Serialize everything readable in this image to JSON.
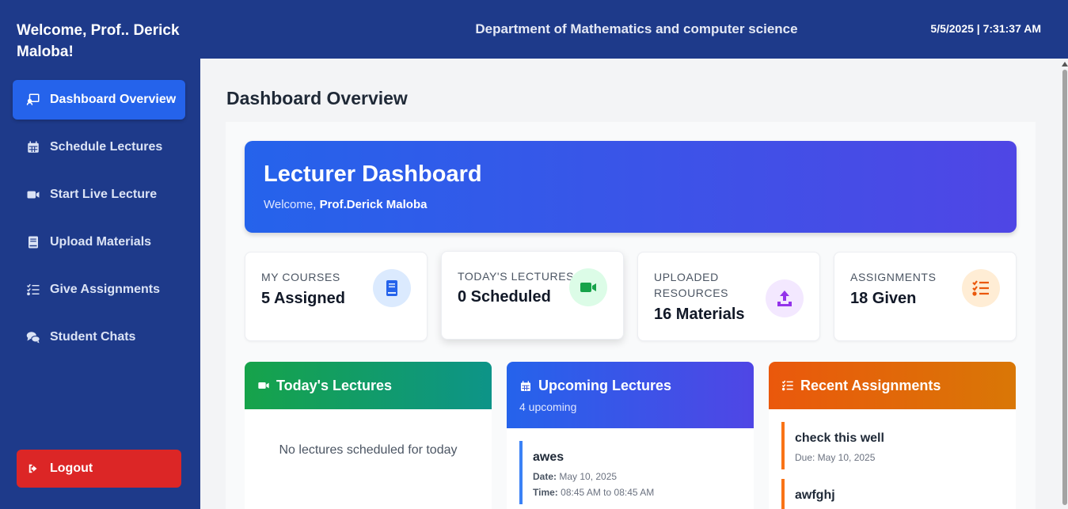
{
  "sidebar": {
    "welcome": "Welcome, Prof.. Derick Maloba!",
    "items": [
      {
        "label": "Dashboard Overview",
        "icon": "dashboard-icon"
      },
      {
        "label": "Schedule Lectures",
        "icon": "calendar-icon"
      },
      {
        "label": "Start Live Lecture",
        "icon": "video-icon"
      },
      {
        "label": "Upload Materials",
        "icon": "book-icon"
      },
      {
        "label": "Give Assignments",
        "icon": "tasks-icon"
      },
      {
        "label": "Student Chats",
        "icon": "chat-icon"
      }
    ],
    "logout": "Logout"
  },
  "header": {
    "department": "Department of Mathematics and computer science",
    "datetime": "5/5/2025 | 7:31:37 AM"
  },
  "main": {
    "title": "Dashboard Overview",
    "hero": {
      "title": "Lecturer Dashboard",
      "welcome_prefix": "Welcome, ",
      "welcome_name": "Prof.Derick Maloba"
    },
    "stats": [
      {
        "label": "MY COURSES",
        "value": "5 Assigned",
        "icon": "book-icon",
        "icon_color": "#2563eb",
        "bg": "#dbeafe"
      },
      {
        "label": "TODAY'S LECTURES",
        "value": "0 Scheduled",
        "icon": "video-icon",
        "icon_color": "#16a34a",
        "bg": "#dcfce7"
      },
      {
        "label": "UPLOADED RESOURCES",
        "value": "16 Materials",
        "icon": "upload-icon",
        "icon_color": "#9333ea",
        "bg": "#f3e8ff"
      },
      {
        "label": "ASSIGNMENTS",
        "value": "18 Given",
        "icon": "tasks-icon",
        "icon_color": "#ea580c",
        "bg": "#ffedd5"
      }
    ],
    "todays_lectures": {
      "title": "Today's Lectures",
      "empty": "No lectures scheduled for today"
    },
    "upcoming_lectures": {
      "title": "Upcoming Lectures",
      "count": "4 upcoming",
      "items": [
        {
          "name": "awes",
          "date_label": "Date:",
          "date": "May 10, 2025",
          "time_label": "Time:",
          "time": "08:45 AM to 08:45 AM"
        }
      ]
    },
    "recent_assignments": {
      "title": "Recent Assignments",
      "items": [
        {
          "name": "check this well",
          "due": "Due: May 10, 2025"
        },
        {
          "name": "awfghj",
          "due": ""
        }
      ]
    }
  }
}
